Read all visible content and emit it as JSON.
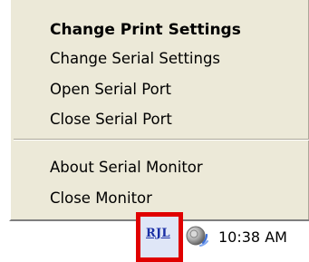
{
  "context_menu": {
    "items": [
      {
        "label": "Change Print Settings",
        "default": true
      },
      {
        "label": "Change Serial Settings"
      },
      {
        "label": "Open Serial Port"
      },
      {
        "label": "Close Serial Port"
      },
      {
        "label": "About Serial Monitor"
      },
      {
        "label": "Close Monitor"
      }
    ]
  },
  "taskbar": {
    "tray_icons": [
      {
        "icon": "rjl-app-icon",
        "label": "RJL",
        "highlight_color": "#e00000"
      },
      {
        "icon": "volume-icon"
      }
    ],
    "clock": "10:38 AM"
  },
  "colors": {
    "menu_background": "#ece9d8",
    "highlight_border": "#e00000",
    "rjl_text": "#1a2fa5"
  }
}
